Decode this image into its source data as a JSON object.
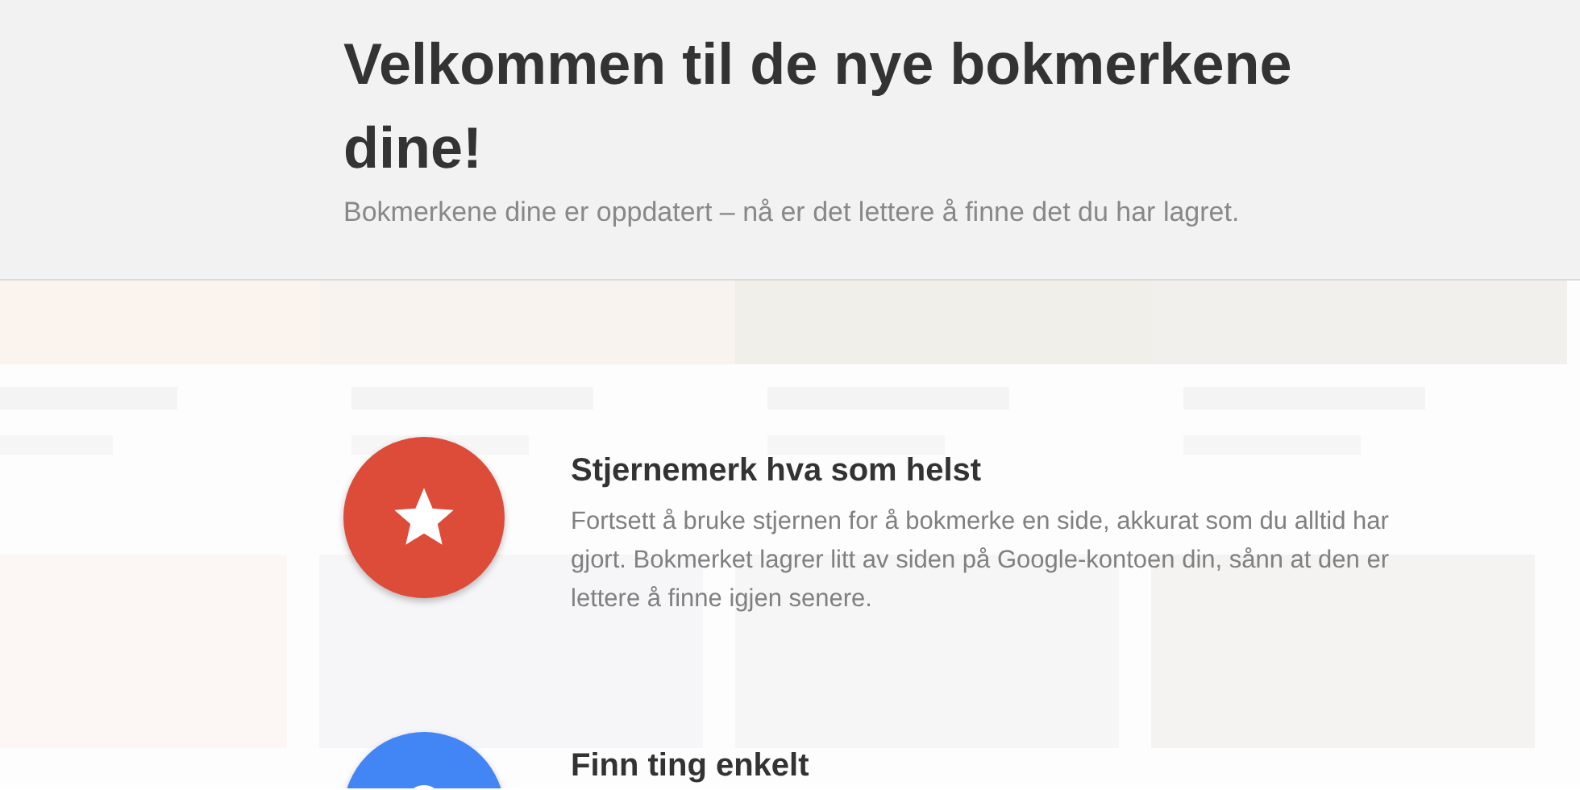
{
  "header": {
    "title": "Velkommen til de nye bokmerkene dine!",
    "subtitle": "Bokmerkene dine er oppdatert – nå er det lettere å finne det du har lagret."
  },
  "features": [
    {
      "kind": "star",
      "color": "#dd4b39",
      "title": "Stjernemerk hva som helst",
      "description": "Fortsett å bruke stjernen for å bokmerke en side, akkurat som du alltid har gjort. Bokmerket lagrer litt av siden på Google-kontoen din, sånn at den er lettere å finne igjen senere."
    },
    {
      "kind": "search",
      "color": "#4285f4",
      "title": "Finn ting enkelt"
    }
  ]
}
